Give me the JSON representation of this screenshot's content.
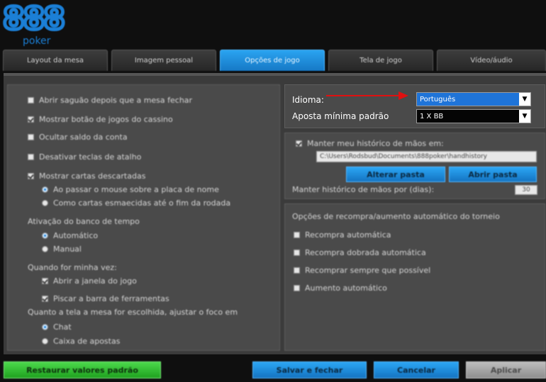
{
  "brand": {
    "logo_number": "888",
    "logo_word": "poker",
    "accent": "#1b7fd6"
  },
  "tabs": [
    {
      "label": "Layout da mesa"
    },
    {
      "label": "Imagem pessoal"
    },
    {
      "label": "Opções de jogo"
    },
    {
      "label": "Tela de jogo"
    },
    {
      "label": "Vídeo/áudio"
    }
  ],
  "left": {
    "options": [
      {
        "label": "Abrir saguão depois que a mesa fechar",
        "checked": false
      },
      {
        "label": "Mostrar botão de jogos do cassino",
        "checked": true
      },
      {
        "label": "Ocultar saldo da conta",
        "checked": false
      },
      {
        "label": "Desativar teclas de atalho",
        "checked": false
      },
      {
        "label": "Mostrar cartas descartadas",
        "checked": true
      }
    ],
    "discard_radios": [
      {
        "label": "Ao passar o mouse sobre a placa de nome",
        "checked": true
      },
      {
        "label": "Como cartas esmaecidas até o fim da rodada",
        "checked": false
      }
    ],
    "time_bank_label": "Ativação do banco de tempo",
    "time_bank_radios": [
      {
        "label": "Automático",
        "checked": true
      },
      {
        "label": "Manual",
        "checked": false
      }
    ],
    "my_turn_label": "Quando for minha vez:",
    "my_turn_options": [
      {
        "label": "Abrir a janela do jogo",
        "checked": true
      },
      {
        "label": "Piscar a barra de ferramentas",
        "checked": true
      }
    ],
    "focus_label": "Quanto a tela a mesa for escolhida, ajustar o foco em",
    "focus_radios": [
      {
        "label": "Chat",
        "checked": true
      },
      {
        "label": "Caixa de apostas",
        "checked": false
      }
    ]
  },
  "right_top": {
    "language_label": "Idioma:",
    "language_value": "Português",
    "min_bet_label": "Aposta mínima padrão",
    "min_bet_value": "1 X BB"
  },
  "right_mid": {
    "history_checkbox_label": "Manter meu histórico de mãos em:",
    "history_path": "C:\\Users\\Rodsbud\\Documents\\888poker\\handhistory",
    "change_folder_button": "Alterar pasta",
    "open_folder_button": "Abrir pasta",
    "keep_days_label": "Manter histórico de mãos por (dias):",
    "keep_days_value": "30"
  },
  "right_bot": {
    "title": "Opções de recompra/aumento automático do torneio",
    "options": [
      {
        "label": "Recompra automática"
      },
      {
        "label": "Recompra dobrada automática"
      },
      {
        "label": "Recomprar sempre que possível"
      },
      {
        "label": "Aumento automático"
      }
    ]
  },
  "footer": {
    "restore_button": "Restaurar valores padrão",
    "save_button": "Salvar e fechar",
    "cancel_button": "Cancelar",
    "apply_button": "Aplicar"
  }
}
